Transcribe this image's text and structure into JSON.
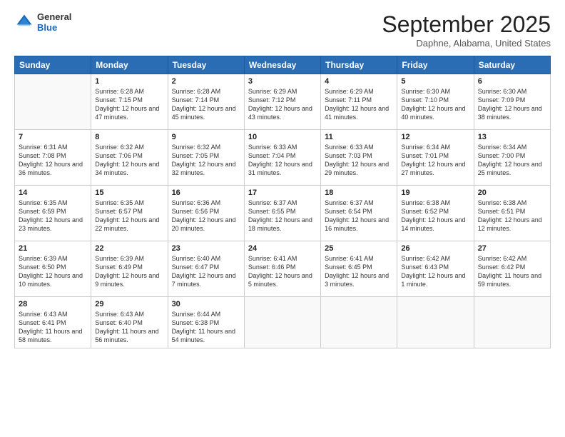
{
  "logo": {
    "general": "General",
    "blue": "Blue"
  },
  "header": {
    "month": "September 2025",
    "location": "Daphne, Alabama, United States"
  },
  "weekdays": [
    "Sunday",
    "Monday",
    "Tuesday",
    "Wednesday",
    "Thursday",
    "Friday",
    "Saturday"
  ],
  "weeks": [
    [
      {
        "day": "",
        "info": ""
      },
      {
        "day": "1",
        "info": "Sunrise: 6:28 AM\nSunset: 7:15 PM\nDaylight: 12 hours\nand 47 minutes."
      },
      {
        "day": "2",
        "info": "Sunrise: 6:28 AM\nSunset: 7:14 PM\nDaylight: 12 hours\nand 45 minutes."
      },
      {
        "day": "3",
        "info": "Sunrise: 6:29 AM\nSunset: 7:12 PM\nDaylight: 12 hours\nand 43 minutes."
      },
      {
        "day": "4",
        "info": "Sunrise: 6:29 AM\nSunset: 7:11 PM\nDaylight: 12 hours\nand 41 minutes."
      },
      {
        "day": "5",
        "info": "Sunrise: 6:30 AM\nSunset: 7:10 PM\nDaylight: 12 hours\nand 40 minutes."
      },
      {
        "day": "6",
        "info": "Sunrise: 6:30 AM\nSunset: 7:09 PM\nDaylight: 12 hours\nand 38 minutes."
      }
    ],
    [
      {
        "day": "7",
        "info": "Sunrise: 6:31 AM\nSunset: 7:08 PM\nDaylight: 12 hours\nand 36 minutes."
      },
      {
        "day": "8",
        "info": "Sunrise: 6:32 AM\nSunset: 7:06 PM\nDaylight: 12 hours\nand 34 minutes."
      },
      {
        "day": "9",
        "info": "Sunrise: 6:32 AM\nSunset: 7:05 PM\nDaylight: 12 hours\nand 32 minutes."
      },
      {
        "day": "10",
        "info": "Sunrise: 6:33 AM\nSunset: 7:04 PM\nDaylight: 12 hours\nand 31 minutes."
      },
      {
        "day": "11",
        "info": "Sunrise: 6:33 AM\nSunset: 7:03 PM\nDaylight: 12 hours\nand 29 minutes."
      },
      {
        "day": "12",
        "info": "Sunrise: 6:34 AM\nSunset: 7:01 PM\nDaylight: 12 hours\nand 27 minutes."
      },
      {
        "day": "13",
        "info": "Sunrise: 6:34 AM\nSunset: 7:00 PM\nDaylight: 12 hours\nand 25 minutes."
      }
    ],
    [
      {
        "day": "14",
        "info": "Sunrise: 6:35 AM\nSunset: 6:59 PM\nDaylight: 12 hours\nand 23 minutes."
      },
      {
        "day": "15",
        "info": "Sunrise: 6:35 AM\nSunset: 6:57 PM\nDaylight: 12 hours\nand 22 minutes."
      },
      {
        "day": "16",
        "info": "Sunrise: 6:36 AM\nSunset: 6:56 PM\nDaylight: 12 hours\nand 20 minutes."
      },
      {
        "day": "17",
        "info": "Sunrise: 6:37 AM\nSunset: 6:55 PM\nDaylight: 12 hours\nand 18 minutes."
      },
      {
        "day": "18",
        "info": "Sunrise: 6:37 AM\nSunset: 6:54 PM\nDaylight: 12 hours\nand 16 minutes."
      },
      {
        "day": "19",
        "info": "Sunrise: 6:38 AM\nSunset: 6:52 PM\nDaylight: 12 hours\nand 14 minutes."
      },
      {
        "day": "20",
        "info": "Sunrise: 6:38 AM\nSunset: 6:51 PM\nDaylight: 12 hours\nand 12 minutes."
      }
    ],
    [
      {
        "day": "21",
        "info": "Sunrise: 6:39 AM\nSunset: 6:50 PM\nDaylight: 12 hours\nand 10 minutes."
      },
      {
        "day": "22",
        "info": "Sunrise: 6:39 AM\nSunset: 6:49 PM\nDaylight: 12 hours\nand 9 minutes."
      },
      {
        "day": "23",
        "info": "Sunrise: 6:40 AM\nSunset: 6:47 PM\nDaylight: 12 hours\nand 7 minutes."
      },
      {
        "day": "24",
        "info": "Sunrise: 6:41 AM\nSunset: 6:46 PM\nDaylight: 12 hours\nand 5 minutes."
      },
      {
        "day": "25",
        "info": "Sunrise: 6:41 AM\nSunset: 6:45 PM\nDaylight: 12 hours\nand 3 minutes."
      },
      {
        "day": "26",
        "info": "Sunrise: 6:42 AM\nSunset: 6:43 PM\nDaylight: 12 hours\nand 1 minute."
      },
      {
        "day": "27",
        "info": "Sunrise: 6:42 AM\nSunset: 6:42 PM\nDaylight: 11 hours\nand 59 minutes."
      }
    ],
    [
      {
        "day": "28",
        "info": "Sunrise: 6:43 AM\nSunset: 6:41 PM\nDaylight: 11 hours\nand 58 minutes."
      },
      {
        "day": "29",
        "info": "Sunrise: 6:43 AM\nSunset: 6:40 PM\nDaylight: 11 hours\nand 56 minutes."
      },
      {
        "day": "30",
        "info": "Sunrise: 6:44 AM\nSunset: 6:38 PM\nDaylight: 11 hours\nand 54 minutes."
      },
      {
        "day": "",
        "info": ""
      },
      {
        "day": "",
        "info": ""
      },
      {
        "day": "",
        "info": ""
      },
      {
        "day": "",
        "info": ""
      }
    ]
  ]
}
